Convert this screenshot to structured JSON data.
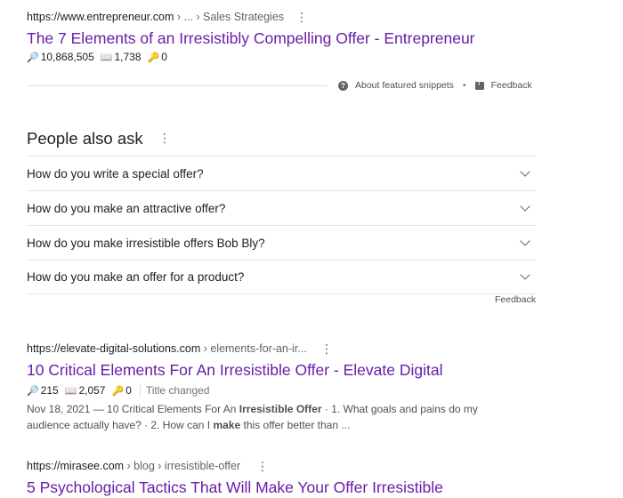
{
  "result1": {
    "url_domain": "https://www.entrepreneur.com",
    "url_path": " › ... › Sales Strategies",
    "title": "The 7 Elements of an Irresistibly Compelling Offer - Entrepreneur",
    "stat_search": "10,868,505",
    "stat_book": "1,738",
    "stat_key": "0"
  },
  "snippet_bar": {
    "about": "About featured snippets",
    "separator": "•",
    "feedback": "Feedback"
  },
  "paa": {
    "title": "People also ask",
    "questions": [
      "How do you write a special offer?",
      "How do you make an attractive offer?",
      "How do you make irresistible offers Bob Bly?",
      "How do you make an offer for a product?"
    ],
    "feedback": "Feedback"
  },
  "result2": {
    "url_domain": "https://elevate-digital-solutions.com",
    "url_path": " › elements-for-an-ir...",
    "title": "10 Critical Elements For An Irresistible Offer - Elevate Digital",
    "stat_search": "215",
    "stat_book": "2,057",
    "stat_key": "0",
    "tag": "Title changed",
    "snippet_line1_a": "Nov 18, 2021 — 10 Critical Elements For An ",
    "snippet_line1_b": "Irresistible Offer",
    "snippet_line1_c": " · 1. What goals and pains do my",
    "snippet_line2_a": "audience actually have? · 2. How can I ",
    "snippet_line2_b": "make",
    "snippet_line2_c": " this offer better than ..."
  },
  "result3": {
    "url_domain": "https://mirasee.com",
    "url_path": " › blog › irresistible-offer",
    "title": "5 Psychological Tactics That Will Make Your Offer Irresistible"
  },
  "icons": {
    "search": "🔎",
    "book": "📖",
    "key": "🔑",
    "kebab": "⋮"
  },
  "colors": {
    "link_visited": "#681da8",
    "text": "#202124",
    "muted": "#5f6368"
  }
}
